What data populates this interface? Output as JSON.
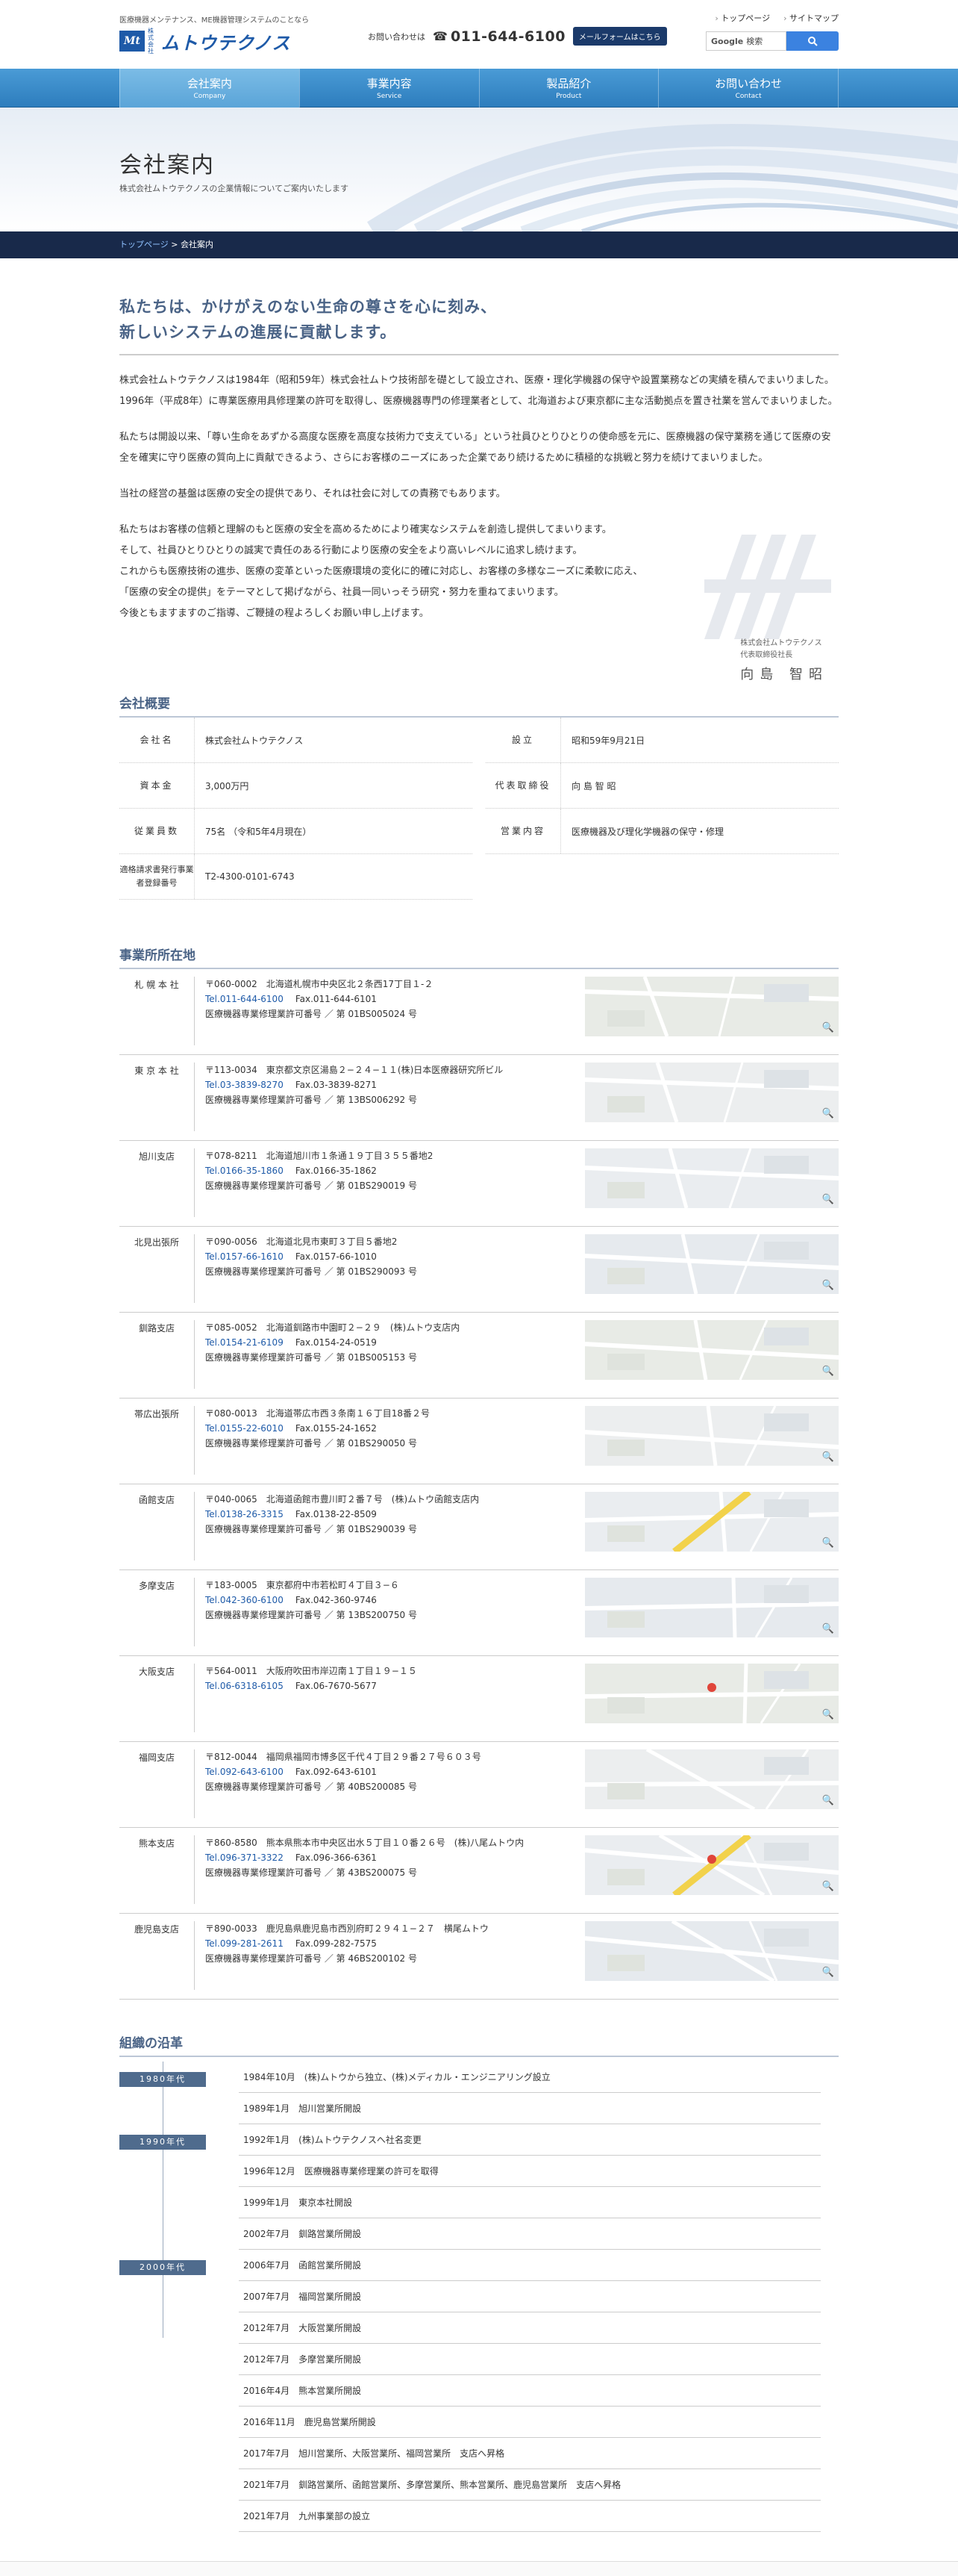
{
  "header": {
    "tagline": "医療機器メンテナンス、ME機器管理システムのことなら",
    "logo_mark": "Mt",
    "logo_sub": "株式会社",
    "logo_name": "ムトウテクノス",
    "contact_label": "お問い合わせは",
    "phone": "011-644-6100",
    "mail_button": "メールフォームはこちら",
    "top_links": [
      "トップページ",
      "サイトマップ"
    ],
    "search_brand": "Google",
    "search_placeholder": "検索"
  },
  "nav": [
    {
      "jp": "会社案内",
      "en": "Company"
    },
    {
      "jp": "事業内容",
      "en": "Service"
    },
    {
      "jp": "製品紹介",
      "en": "Product"
    },
    {
      "jp": "お問い合わせ",
      "en": "Contact"
    }
  ],
  "hero": {
    "title": "会社案内",
    "subtitle": "株式会社ムトウテクノスの企業情報についてご案内いたします"
  },
  "breadcrumb": {
    "home": "トップページ",
    "sep": " > ",
    "current": "会社案内"
  },
  "intro": {
    "lead1": "私たちは、かけがえのない生命の尊さを心に刻み、",
    "lead2": "新しいシステムの進展に貢献します。",
    "p1": "株式会社ムトウテクノスは1984年（昭和59年）株式会社ムトウ技術部を礎として設立され、医療・理化学機器の保守や設置業務などの実績を積んでまいりました。1996年（平成8年）に専業医療用具修理業の許可を取得し、医療機器専門の修理業者として、北海道および東京都に主な活動拠点を置き社業を営んでまいりました。",
    "p2": "私たちは開設以来、「尊い生命をあずかる高度な医療を高度な技術力で支えている」という社員ひとりひとりの使命感を元に、医療機器の保守業務を通じて医療の安全を確実に守り医療の質向上に貢献できるよう、さらにお客様のニーズにあった企業であり続けるために積極的な挑戦と努力を続けてまいりました。",
    "p3": "当社の経営の基盤は医療の安全の提供であり、それは社会に対しての責務でもあります。",
    "c1": "私たちはお客様の信頼と理解のもと医療の安全を高めるためにより確実なシステムを創造し提供してまいります。",
    "c2": "そして、社員ひとりひとりの誠実で責任のある行動により医療の安全をより高いレベルに追求し続けます。",
    "c3": "これからも医療技術の進歩、医療の変革といった医療環境の変化に的確に対応し、お客様の多様なニーズに柔軟に応え、",
    "c4": "「医療の安全の提供」をテーマとして掲げながら、社員一同いっそう研究・努力を重ねてまいります。",
    "c5": "今後ともますますのご指導、ご鞭撻の程よろしくお願い申し上げます。",
    "sign_company": "株式会社ムトウテクノス",
    "sign_title": "代表取締役社長",
    "sign_name": "向島 智昭"
  },
  "overview": {
    "heading": "会社概要",
    "rows": [
      {
        "k": "会社名",
        "v": "株式会社ムトウテクノス"
      },
      {
        "k": "設立",
        "v": "昭和59年9月21日"
      },
      {
        "k": "資本金",
        "v": "3,000万円"
      },
      {
        "k": "代表取締役",
        "v": "向 島 智 昭"
      },
      {
        "k": "従業員数",
        "v": "75名 （令和5年4月現在）"
      },
      {
        "k": "営業内容",
        "v": "医療機器及び理化学機器の保守・修理"
      },
      {
        "k": "適格請求書発行事業者登録番号",
        "v": "T2-4300-0101-6743"
      }
    ]
  },
  "locations": {
    "heading": "事業所所在地",
    "offices": [
      {
        "name": "札 幌 本 社",
        "addr": "〒060-0002　北海道札幌市中央区北２条西17丁目１-２",
        "tel": "Tel.011-644-6100",
        "fax": "Fax.011-644-6101",
        "lic": "医療機器専業修理業許可番号 ／ 第 01BS005024 号"
      },
      {
        "name": "東 京 本 社",
        "addr": "〒113-0034　東京都文京区湯島２−２４−１１(株)日本医療器研究所ビル",
        "tel": "Tel.03-3839-8270",
        "fax": "Fax.03-3839-8271",
        "lic": "医療機器専業修理業許可番号 ／ 第 13BS006292 号"
      },
      {
        "name": "旭川支店",
        "addr": "〒078-8211　北海道旭川市１条通１９丁目３５５番地2",
        "tel": "Tel.0166-35-1860",
        "fax": "Fax.0166-35-1862",
        "lic": "医療機器専業修理業許可番号 ／ 第 01BS290019 号"
      },
      {
        "name": "北見出張所",
        "addr": "〒090-0056　北海道北見市東町３丁目５番地2",
        "tel": "Tel.0157-66-1610",
        "fax": "Fax.0157-66-1010",
        "lic": "医療機器専業修理業許可番号 ／ 第 01BS290093 号"
      },
      {
        "name": "釧路支店",
        "addr": "〒085-0052　北海道釧路市中園町２−２９　(株)ムトウ支店内",
        "tel": "Tel.0154-21-6109",
        "fax": "Fax.0154-24-0519",
        "lic": "医療機器専業修理業許可番号 ／ 第 01BS005153 号"
      },
      {
        "name": "帯広出張所",
        "addr": "〒080-0013　北海道帯広市西３条南１６丁目18番２号",
        "tel": "Tel.0155-22-6010",
        "fax": "Fax.0155-24-1652",
        "lic": "医療機器専業修理業許可番号 ／ 第 01BS290050 号"
      },
      {
        "name": "函館支店",
        "addr": "〒040-0065　北海道函館市豊川町２番７号　(株)ムトウ函館支店内",
        "tel": "Tel.0138-26-3315",
        "fax": "Fax.0138-22-8509",
        "lic": "医療機器専業修理業許可番号 ／ 第 01BS290039 号"
      },
      {
        "name": "多摩支店",
        "addr": "〒183-0005　東京都府中市若松町４丁目３−６",
        "tel": "Tel.042-360-6100",
        "fax": "Fax.042-360-9746",
        "lic": "医療機器専業修理業許可番号 ／ 第 13BS200750 号"
      },
      {
        "name": "大阪支店",
        "addr": "〒564-0011　大阪府吹田市岸辺南１丁目１９−１５",
        "tel": "Tel.06-6318-6105",
        "fax": "Fax.06-7670-5677",
        "lic": ""
      },
      {
        "name": "福岡支店",
        "addr": "〒812-0044　福岡県福岡市博多区千代４丁目２９番２７号６０３号",
        "tel": "Tel.092-643-6100",
        "fax": "Fax.092-643-6101",
        "lic": "医療機器専業修理業許可番号 ／ 第 40BS200085 号"
      },
      {
        "name": "熊本支店",
        "addr": "〒860-8580　熊本県熊本市中央区出水５丁目１０番２６号　(株)八尾ムトウ内",
        "tel": "Tel.096-371-3322",
        "fax": "Fax.096-366-6361",
        "lic": "医療機器専業修理業許可番号 ／ 第 43BS200075 号"
      },
      {
        "name": "鹿児島支店",
        "addr": "〒890-0033　鹿児島県鹿児島市西別府町２９４１−２７　横尾ムトウ",
        "tel": "Tel.099-281-2611",
        "fax": "Fax.099-282-7575",
        "lic": "医療機器専業修理業許可番号 ／ 第 46BS200102 号"
      }
    ]
  },
  "history": {
    "heading": "組織の沿革",
    "eras": [
      "1980年代",
      "1990年代",
      "2000年代"
    ],
    "events": [
      "1984年10月　(株)ムトウから独立、(株)メディカル・エンジニアリング設立",
      "1989年1月　旭川営業所開設",
      "1992年1月　(株)ムトウテクノスへ社名変更",
      "1996年12月　医療機器専業修理業の許可を取得",
      "1999年1月　東京本社開設",
      "2002年7月　釧路営業所開設",
      "2006年7月　函館営業所開設",
      "2007年7月　福岡営業所開設",
      "2012年7月　大阪営業所開設",
      "2012年7月　多摩営業所開設",
      "2016年4月　熊本営業所開設",
      "2016年11月　鹿児島営業所開設",
      "2017年7月　旭川営業所、大阪営業所、福岡営業所　支店へ昇格",
      "2021年7月　釧路営業所、函館営業所、多摩営業所、熊本営業所、鹿児島営業所　支店へ昇格",
      "2021年7月　九州事業部の設立"
    ]
  },
  "colors": {
    "nav": "#2d7dbd",
    "breadcrumb": "#18294a",
    "heading": "#4a6386",
    "era": "#4f6b8d"
  }
}
